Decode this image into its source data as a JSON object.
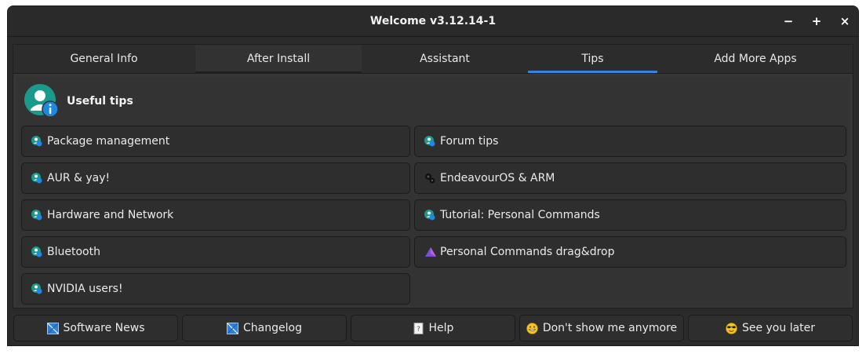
{
  "window": {
    "title": "Welcome v3.12.14-1",
    "minimize": "−",
    "maximize": "+",
    "close": "×"
  },
  "tabs": [
    {
      "label": "General Info"
    },
    {
      "label": "After Install"
    },
    {
      "label": "Assistant"
    },
    {
      "label": "Tips",
      "active": true
    },
    {
      "label": "Add More Apps"
    }
  ],
  "tips_page": {
    "header": "Useful tips",
    "left": [
      {
        "label": "Package management",
        "icon": "user-info-icon"
      },
      {
        "label": "AUR & yay!",
        "icon": "user-info-icon"
      },
      {
        "label": "Hardware and Network",
        "icon": "user-info-icon"
      },
      {
        "label": "Bluetooth",
        "icon": "user-info-icon"
      },
      {
        "label": "NVIDIA users!",
        "icon": "user-info-icon"
      }
    ],
    "right": [
      {
        "label": "Forum tips",
        "icon": "user-info-icon"
      },
      {
        "label": "EndeavourOS & ARM",
        "icon": "gears-icon"
      },
      {
        "label": "Tutorial: Personal Commands",
        "icon": "user-info-icon"
      },
      {
        "label": "Personal Commands drag&drop",
        "icon": "purple-triangle-icon"
      }
    ]
  },
  "bottom_buttons": [
    {
      "label": "Software News",
      "icon": "news-icon"
    },
    {
      "label": "Changelog",
      "icon": "news-icon"
    },
    {
      "label": "Help",
      "icon": "help-icon"
    },
    {
      "label": "Don't show me anymore",
      "icon": "grin-emoji-icon"
    },
    {
      "label": "See you later",
      "icon": "sunglasses-emoji-icon"
    }
  ],
  "colors": {
    "accent": "#3584e4",
    "window_bg": "#2b2b2b",
    "button_bg": "#2e2e2e",
    "teal": "#1a9a8a"
  }
}
